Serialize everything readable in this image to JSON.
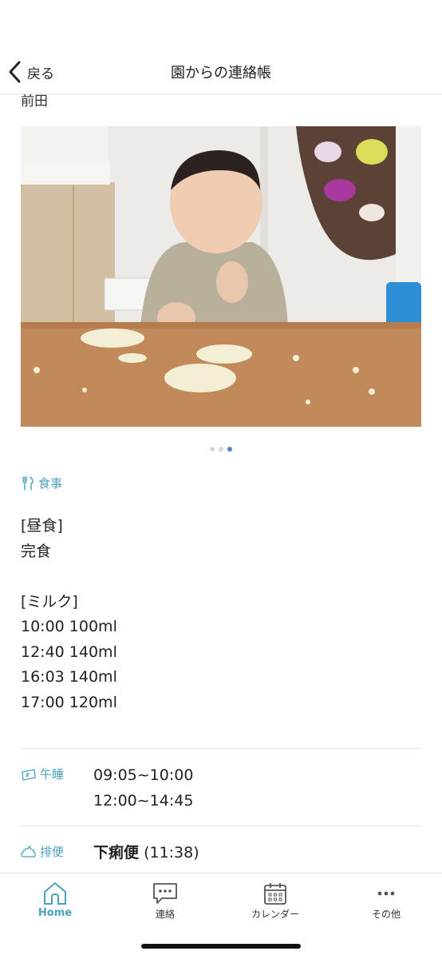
{
  "header": {
    "back_label": "戻る",
    "title": "園からの連絡帳"
  },
  "content": {
    "cut_text": "前田"
  },
  "photo": {
    "description_icon": "photo-of-child-eating"
  },
  "carousel": {
    "count": 3,
    "active_index": 2
  },
  "meal": {
    "heading": "食事",
    "lines": [
      "[昼食]",
      "完食",
      "",
      "[ミルク]",
      "10:00 100ml",
      "12:40 140ml",
      "16:03 140ml",
      "17:00 120ml"
    ]
  },
  "nap": {
    "heading": "午睡",
    "times": [
      "09:05~10:00",
      "12:00~14:45"
    ]
  },
  "excretion": {
    "heading": "排便",
    "value_bold": "下痢便",
    "value_time": "(11:38)"
  },
  "tabs": [
    {
      "label": "Home",
      "icon": "home-icon",
      "active": true
    },
    {
      "label": "連絡",
      "icon": "chat-icon",
      "active": false
    },
    {
      "label": "カレンダー",
      "icon": "calendar-icon",
      "active": false
    },
    {
      "label": "その他",
      "icon": "more-icon",
      "active": false
    }
  ],
  "colors": {
    "accent": "#4aa2bd",
    "dot_active": "#4a86c8"
  }
}
